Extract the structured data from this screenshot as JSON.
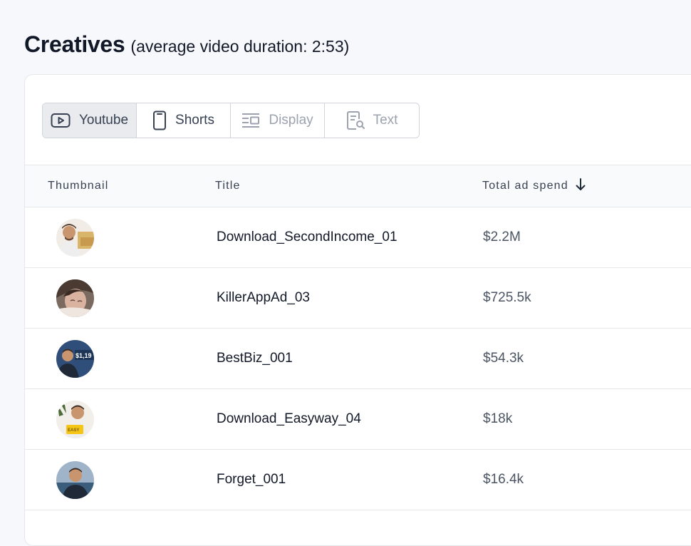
{
  "header": {
    "title": "Creatives",
    "subtitle": "(average video duration: 2:53)"
  },
  "tabs": [
    {
      "label": "Youtube",
      "icon": "youtube-icon",
      "state": "active"
    },
    {
      "label": "Shorts",
      "icon": "phone-icon",
      "state": "enabled"
    },
    {
      "label": "Display",
      "icon": "display-ad-icon",
      "state": "disabled"
    },
    {
      "label": "Text",
      "icon": "text-ad-icon",
      "state": "disabled"
    }
  ],
  "table": {
    "columns": {
      "thumbnail": "Thumbnail",
      "title": "Title",
      "spend": "Total ad spend"
    },
    "sort_icon": "arrow-down-icon",
    "rows": [
      {
        "title": "Download_SecondIncome_01",
        "spend": "$2.2M"
      },
      {
        "title": "KillerAppAd_03",
        "spend": "$725.5k"
      },
      {
        "title": "BestBiz_001",
        "spend": "$54.3k"
      },
      {
        "title": "Download_Easyway_04",
        "spend": "$18k"
      },
      {
        "title": "Forget_001",
        "spend": "$16.4k"
      }
    ]
  },
  "colors": {
    "page_bg": "#f7f8fb",
    "active_tab_bg": "#e9ebee",
    "text_primary": "#111827",
    "text_muted": "#4b5563",
    "text_disabled": "#9ca3af"
  }
}
